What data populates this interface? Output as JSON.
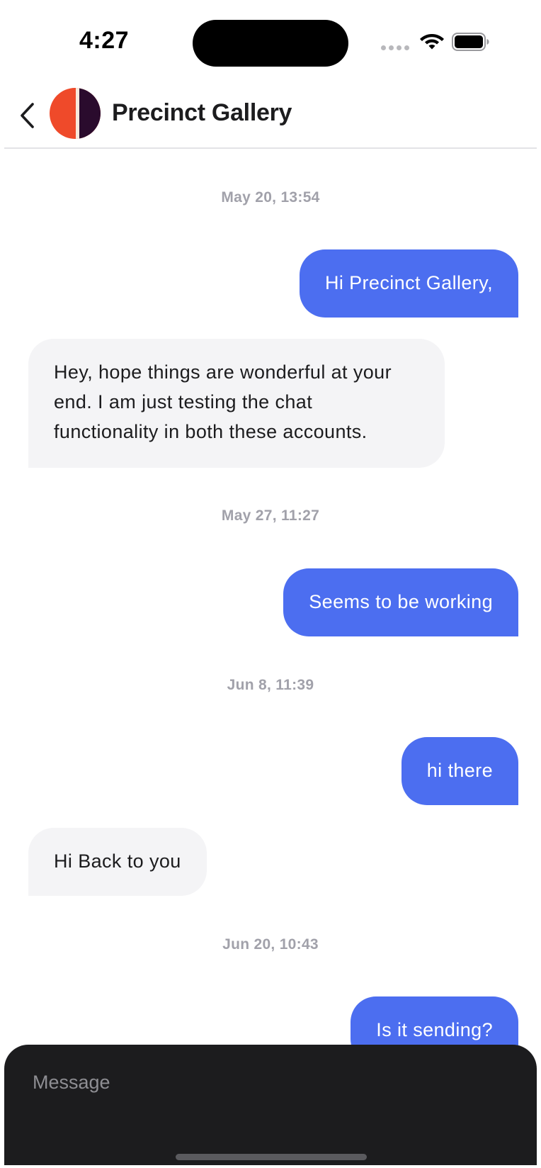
{
  "status_bar": {
    "time": "4:27"
  },
  "header": {
    "back_icon": "chevron-left-icon",
    "contact_name": "Precinct Gallery",
    "avatar_colors": {
      "left": "#ef4a2a",
      "right": "#2a0b2d"
    }
  },
  "conversation": {
    "items": [
      {
        "kind": "timestamp",
        "text": "May 20, 13:54"
      },
      {
        "kind": "outgoing",
        "text": "Hi Precinct Gallery,"
      },
      {
        "kind": "incoming",
        "text": "Hey, hope things are wonderful at your end. I am just testing the chat functionality in both these accounts."
      },
      {
        "kind": "timestamp",
        "text": "May 27, 11:27"
      },
      {
        "kind": "outgoing",
        "text": "Seems to be working"
      },
      {
        "kind": "timestamp",
        "text": "Jun 8, 11:39"
      },
      {
        "kind": "outgoing",
        "text": "hi there"
      },
      {
        "kind": "incoming",
        "text": "Hi Back to you"
      },
      {
        "kind": "timestamp",
        "text": "Jun 20, 10:43"
      },
      {
        "kind": "outgoing",
        "text": "Is it sending?"
      }
    ]
  },
  "composer": {
    "placeholder": "Message",
    "value": ""
  },
  "colors": {
    "outgoing_bubble": "#4c6ef0",
    "incoming_bubble": "#f4f4f6",
    "timestamp": "#a1a1aa",
    "composer_background": "#1c1c1e"
  }
}
